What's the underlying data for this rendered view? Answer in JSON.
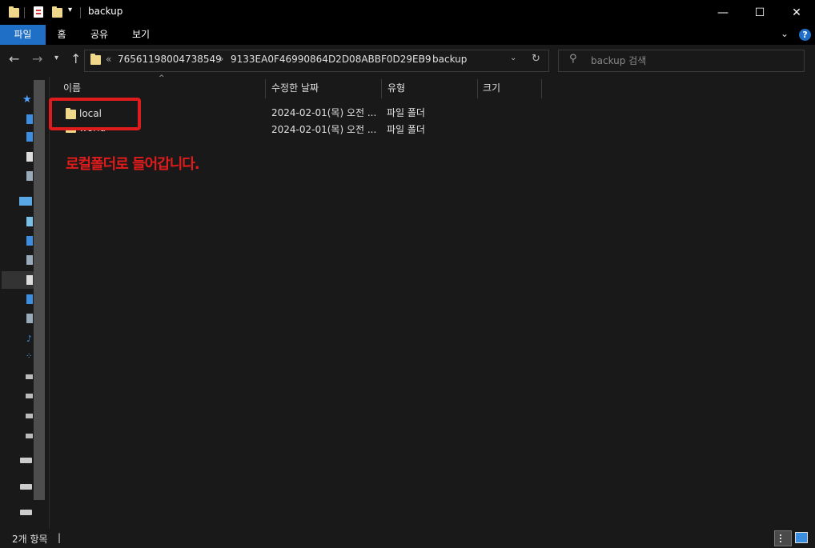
{
  "window": {
    "title": "backup"
  },
  "ribbon": {
    "tabs": [
      "파일",
      "홈",
      "공유",
      "보기"
    ]
  },
  "address": {
    "overflow": "«",
    "crumbs": [
      "76561198004738549",
      "9133EA0F46990864D2D08ABBF0D29EB9",
      "backup"
    ]
  },
  "search": {
    "placeholder": "backup 검색"
  },
  "columns": {
    "name": "이름",
    "modified": "수정한 날짜",
    "type": "유형",
    "size": "크기"
  },
  "files": [
    {
      "name": "local",
      "modified": "2024-02-01(목) 오전 ...",
      "type": "파일 폴더"
    },
    {
      "name": "world",
      "modified": "2024-02-01(목) 오전 ...",
      "type": "파일 폴더"
    }
  ],
  "annotation": {
    "text": "로컬폴더로 들어갑니다.",
    "color": "#e01b1b"
  },
  "status": {
    "items": "2개 항목"
  },
  "colors": {
    "accent": "#1e6fc5",
    "background": "#191919",
    "titlebar": "#000000"
  }
}
